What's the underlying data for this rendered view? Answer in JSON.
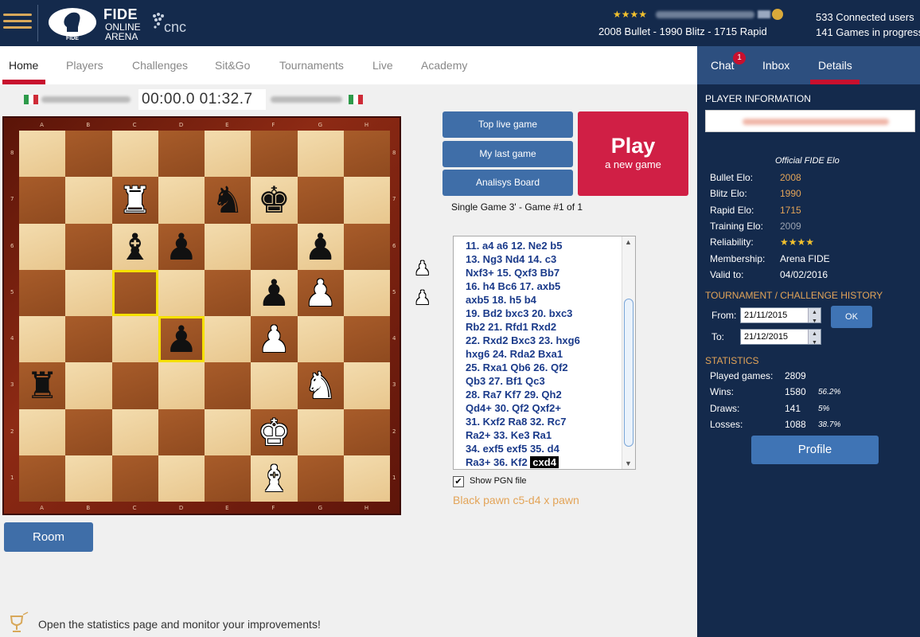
{
  "header": {
    "logo_fide": "FIDE",
    "logo_online": "ONLINE",
    "logo_arena": "ARENA",
    "logo_badge_text": "FIDE",
    "cnc": "cnc",
    "user_stars": "★★★★",
    "user_elo": "2008 Bullet - 1990 Blitz - 1715 Rapid",
    "connected_users": "533 Connected users",
    "games_in_progress": "141 Games in progress"
  },
  "nav": {
    "items": [
      "Home",
      "Players",
      "Challenges",
      "Sit&Go",
      "Tournaments",
      "Live",
      "Academy"
    ],
    "active": "Home"
  },
  "game": {
    "clock": "00:00.0 01:32.7",
    "single_game": "Single Game 3' - Game #1 of 1",
    "show_pgn_label": "Show PGN file",
    "show_pgn_checked": true,
    "last_move_desc": "Black pawn c5-d4 x pawn"
  },
  "buttons": {
    "top_live_game": "Top live game",
    "my_last_game": "My last game",
    "analysis_board": "Analisys Board",
    "play": "Play",
    "play_sub": "a new game",
    "room": "Room"
  },
  "board": {
    "files": [
      "A",
      "B",
      "C",
      "D",
      "E",
      "F",
      "G",
      "H"
    ],
    "ranks": [
      "8",
      "7",
      "6",
      "5",
      "4",
      "3",
      "2",
      "1"
    ],
    "highlights": [
      "c5",
      "d4"
    ],
    "pieces": [
      {
        "square": "c7",
        "piece": "rook",
        "color": "white"
      },
      {
        "square": "e7",
        "piece": "knight",
        "color": "black"
      },
      {
        "square": "f7",
        "piece": "king",
        "color": "black"
      },
      {
        "square": "c6",
        "piece": "bishop",
        "color": "black"
      },
      {
        "square": "d6",
        "piece": "pawn",
        "color": "black"
      },
      {
        "square": "g6",
        "piece": "pawn",
        "color": "black"
      },
      {
        "square": "f5",
        "piece": "pawn",
        "color": "black"
      },
      {
        "square": "g5",
        "piece": "pawn",
        "color": "white"
      },
      {
        "square": "d4",
        "piece": "pawn",
        "color": "black"
      },
      {
        "square": "f4",
        "piece": "pawn",
        "color": "white"
      },
      {
        "square": "a3",
        "piece": "rook",
        "color": "black"
      },
      {
        "square": "g3",
        "piece": "knight",
        "color": "white"
      },
      {
        "square": "f2",
        "piece": "king",
        "color": "white"
      },
      {
        "square": "f1",
        "piece": "bishop",
        "color": "white"
      }
    ],
    "captured": [
      {
        "piece": "pawn",
        "color": "white"
      },
      {
        "piece": "pawn",
        "color": "white"
      }
    ]
  },
  "pgn": {
    "lines": [
      "11. a4   a6   12. Ne2   b5",
      "13. Ng3   Nd4   14. c3",
      "Nxf3+   15. Qxf3   Bb7",
      "16. h4   Bc6   17. axb5",
      "axb5   18. h5   b4",
      "19. Bd2   bxc3   20. bxc3",
      "Rb2   21. Rfd1   Rxd2",
      "22. Rxd2   Bxc3   23. hxg6",
      "hxg6   24. Rda2   Bxa1",
      "25. Rxa1   Qb6   26. Qf2",
      "Qb3   27. Bf1   Qc3",
      "28. Ra7   Kf7   29. Qh2",
      "Qd4+   30. Qf2   Qxf2+",
      "31. Kxf2   Ra8   32. Rc7",
      "Ra2+   33. Ke3   Ra1",
      "34. exf5   exf5   35. d4",
      "Ra3+   36. Kf2  "
    ],
    "current_move": "cxd4"
  },
  "side": {
    "tabs": [
      "Chat",
      "Inbox",
      "Details"
    ],
    "chat_badge": "1",
    "active_tab": "Details",
    "player_info_title": "PLAYER INFORMATION",
    "official_elo": "Official FIDE Elo",
    "ratings": [
      {
        "label": "Bullet Elo:",
        "value": "2008",
        "tone": "orange"
      },
      {
        "label": "Blitz Elo:",
        "value": "1990",
        "tone": "orange"
      },
      {
        "label": "Rapid Elo:",
        "value": "1715",
        "tone": "orange"
      },
      {
        "label": "Training Elo:",
        "value": "2009",
        "tone": "grey"
      },
      {
        "label": "Reliability:",
        "value": "★★★★",
        "tone": "stars"
      },
      {
        "label": "Membership:",
        "value": "Arena FIDE",
        "tone": "white"
      },
      {
        "label": "Valid to:",
        "value": "04/02/2016",
        "tone": "white"
      }
    ],
    "history_title": "TOURNAMENT / CHALLENGE HISTORY",
    "from_label": "From:",
    "from_value": "21/11/2015",
    "to_label": "To:",
    "to_value": "21/12/2015",
    "ok_label": "OK",
    "stats_title": "STATISTICS",
    "stats": [
      {
        "label": "Played games:",
        "value": "2809",
        "pct": ""
      },
      {
        "label": "Wins:",
        "value": "1580",
        "pct": "56.2%"
      },
      {
        "label": "Draws:",
        "value": "141",
        "pct": "5%"
      },
      {
        "label": "Losses:",
        "value": "1088",
        "pct": "38.7%"
      }
    ],
    "profile_label": "Profile"
  },
  "footer": {
    "tip": "Open the statistics page and monitor your improvements!"
  },
  "colors": {
    "navy": "#142a4c",
    "accent_red": "#c8102e",
    "button_blue": "#3f6ea8",
    "orange_value": "#e3a458"
  }
}
